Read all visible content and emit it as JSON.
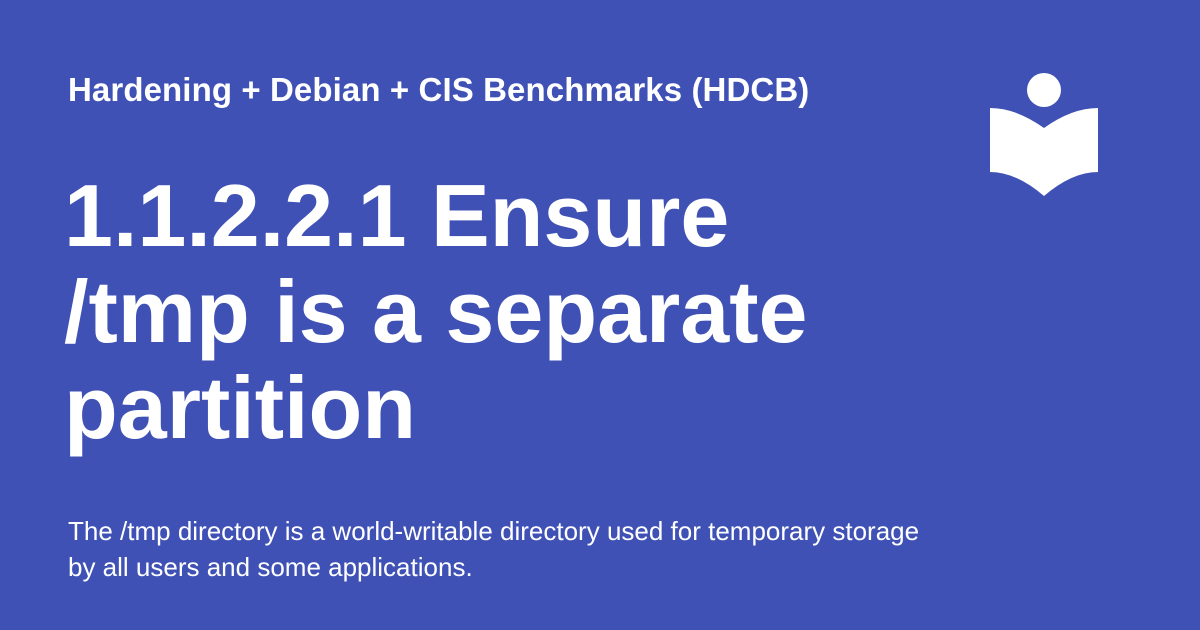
{
  "site": {
    "name": "Hardening + Debian + CIS Benchmarks (HDCB)"
  },
  "page": {
    "title": "1.1.2.2.1 Ensure /tmp is a separate partition",
    "description": "The /tmp directory is a world-writable directory used for temporary storage by all users and some applications."
  },
  "logo": {
    "icon": "reader-book-icon"
  },
  "colors": {
    "background": "#3f51b5",
    "text": "#ffffff"
  }
}
